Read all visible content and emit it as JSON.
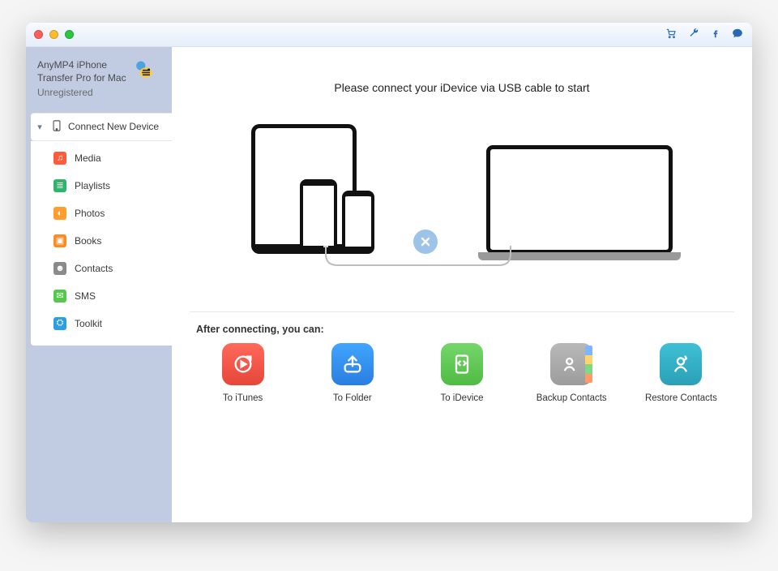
{
  "app": {
    "name_line1": "AnyMP4 iPhone",
    "name_line2": "Transfer Pro for Mac",
    "status": "Unregistered"
  },
  "toolbar_icons": {
    "cart": "cart-icon",
    "wrench": "wrench-icon",
    "facebook": "facebook-icon",
    "chat": "chat-icon"
  },
  "sidebar": {
    "root_label": "Connect New Device",
    "items": [
      {
        "label": "Media",
        "icon": "music-icon",
        "color": "#ff5b3a",
        "glyph": "♫"
      },
      {
        "label": "Playlists",
        "icon": "playlist-icon",
        "color": "#2fb56a",
        "glyph": "≣"
      },
      {
        "label": "Photos",
        "icon": "photos-icon",
        "color": "#ff9e2c",
        "glyph": "◐"
      },
      {
        "label": "Books",
        "icon": "books-icon",
        "color": "#ff8a1f",
        "glyph": "▣"
      },
      {
        "label": "Contacts",
        "icon": "contacts-icon",
        "color": "#8a8a8a",
        "glyph": "☻"
      },
      {
        "label": "SMS",
        "icon": "sms-icon",
        "color": "#55c94e",
        "glyph": "✉"
      },
      {
        "label": "Toolkit",
        "icon": "toolkit-icon",
        "color": "#2d9fe0",
        "glyph": "⛭"
      }
    ]
  },
  "main": {
    "connect_prompt": "Please connect your iDevice via USB cable to start",
    "after_label": "After connecting, you can:",
    "actions": [
      {
        "label": "To iTunes",
        "icon": "to-itunes-icon",
        "tile": "red"
      },
      {
        "label": "To Folder",
        "icon": "to-folder-icon",
        "tile": "blue"
      },
      {
        "label": "To iDevice",
        "icon": "to-idevice-icon",
        "tile": "green"
      },
      {
        "label": "Backup Contacts",
        "icon": "backup-contacts-icon",
        "tile": "grey"
      },
      {
        "label": "Restore Contacts",
        "icon": "restore-contacts-icon",
        "tile": "teal"
      }
    ]
  }
}
